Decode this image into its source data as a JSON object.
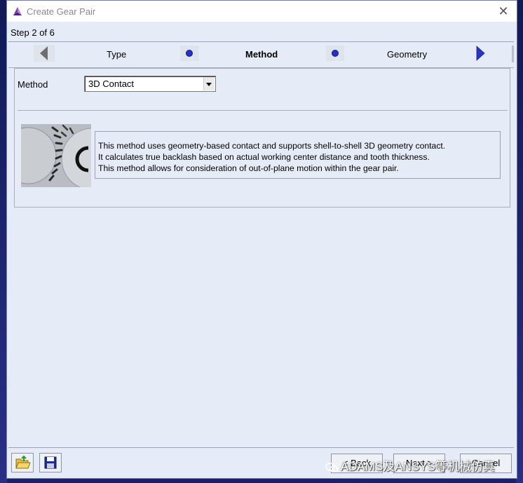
{
  "window": {
    "title": "Create Gear Pair"
  },
  "wizard": {
    "step": "Step 2 of 6",
    "steps": [
      "Type",
      "Method",
      "Geometry"
    ],
    "active_step": "Method"
  },
  "method": {
    "label": "Method",
    "selected": "3D Contact"
  },
  "description": [
    "This method uses geometry-based contact and supports shell-to-shell 3D geometry contact.",
    "It calculates true backlash based on actual working center distance and tooth thickness.",
    "This method allows for consideration of out-of-plane motion within the gear pair."
  ],
  "buttons": {
    "back": "< Back",
    "next": "Next >",
    "cancel": "Cancel"
  },
  "watermark": "ADAMS及ANSYS等机械仿真",
  "colors": {
    "accent_dot": "#2230c9",
    "client_bg": "#e6ecf7",
    "next_arrow": "#2b35c4"
  },
  "icons": {
    "app": "adams-logo-icon",
    "open": "folder-open-icon",
    "save": "floppy-disk-icon"
  }
}
